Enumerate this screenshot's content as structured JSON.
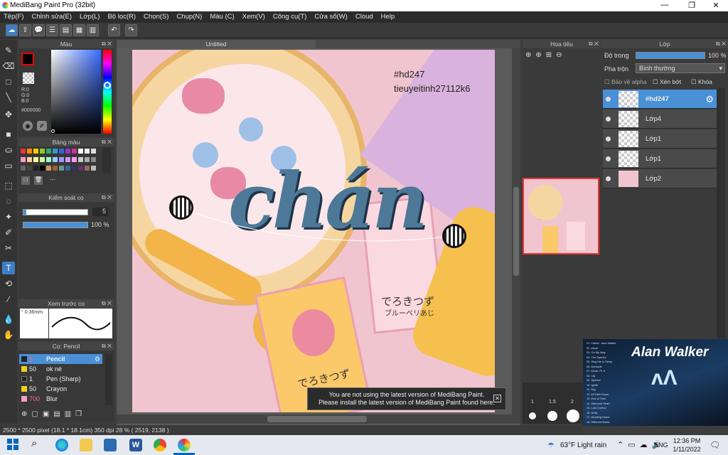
{
  "app": {
    "title": "MediBang Paint Pro (32bit)"
  },
  "window_controls": [
    "—",
    "❐",
    "✕"
  ],
  "menu": [
    "Tệp(F)",
    "Chỉnh sửa(E)",
    "Lớp(L)",
    "Bộ lọc(R)",
    "Chọn(S)",
    "Chụp(N)",
    "Màu (C)",
    "Xem(V)",
    "Công cụ(T)",
    "Cửa sổ(W)",
    "Cloud",
    "Help"
  ],
  "color_panel": {
    "title": "Màu",
    "r": "R:0",
    "g": "G:0",
    "b": "B:0",
    "hex": "#000000"
  },
  "palette_panel": {
    "title": "Bảng màu",
    "extra": "---"
  },
  "brush_control": {
    "title": "Kiểm soát cọ",
    "size": "5",
    "opacity": "100 %"
  },
  "brush_preview": {
    "title": "Xem trước cọ",
    "size": "0.36mm"
  },
  "brush_list": {
    "title": "Cọ: Pencil",
    "items": [
      {
        "size": "5",
        "name": "Pencil",
        "color": "#222"
      },
      {
        "size": "50",
        "name": "ok nè",
        "color": "#e8d020"
      },
      {
        "size": "1",
        "name": "Pen (Sharp)",
        "color": "#222"
      },
      {
        "size": "50",
        "name": "Crayon",
        "color": "#e8d020"
      },
      {
        "size": "700",
        "name": "Blur",
        "color": "#f4a0c8"
      }
    ]
  },
  "canvas": {
    "tab": "Untitled",
    "text1": "#hd247",
    "text2": "tieuyeitinh27112k6",
    "lettering": "chán",
    "jp1": "でろきつず",
    "jp2": "ブルーベリあじ",
    "jp3": "でろきつず"
  },
  "navigator": {
    "title": "Hoa tiêu",
    "brush_sizes": [
      "1",
      "1.5",
      "2"
    ]
  },
  "layers_panel": {
    "title": "Lớp",
    "opacity_label": "Độ trong",
    "opacity_value": "100 %",
    "blend_label": "Pha trộn",
    "blend_value": "Bình thường",
    "protect_alpha": "Bảo vệ alpha",
    "clip": "Xén bớt",
    "lock": "Khóa",
    "layers": [
      {
        "name": "#hd247",
        "selected": true
      },
      {
        "name": "Lớp4",
        "selected": false
      },
      {
        "name": "Lớp1",
        "selected": false
      },
      {
        "name": "Lớp1",
        "selected": false
      },
      {
        "name": "Lớp2",
        "selected": false
      }
    ]
  },
  "notice": {
    "line1": "You are not using the latest version of MediBang Paint.",
    "line2": "Please install the latest version of MediBang Paint found here."
  },
  "status": {
    "size": "2500 * 2500 pixel",
    "cm": "(18.1 * 18.1cm)",
    "dpi": "350 dpi",
    "zoom": "28 %",
    "coords": "( 2519, 2138 )"
  },
  "album": {
    "title": "Alan Walker",
    "tracks": [
      "01. Faded - Alan Walker",
      "02. Alone",
      "03. On My Way",
      "04. The Spectre",
      "05. Sing Me to Sleep",
      "06. Darkside",
      "07. Alone, Pt. II",
      "08. Lily",
      "09. Spectre",
      "10. Ignite",
      "11. Sky",
      "12. All Falls Down",
      "13. End of Time",
      "14. Diamond Heart",
      "15. Lost Control",
      "16. Unity",
      "17. Heading Home",
      "18. Different World"
    ]
  },
  "taskbar": {
    "weather": "63°F  Light rain",
    "lang": "ENG",
    "time": "12:36 PM",
    "date": "1/11/2022"
  }
}
